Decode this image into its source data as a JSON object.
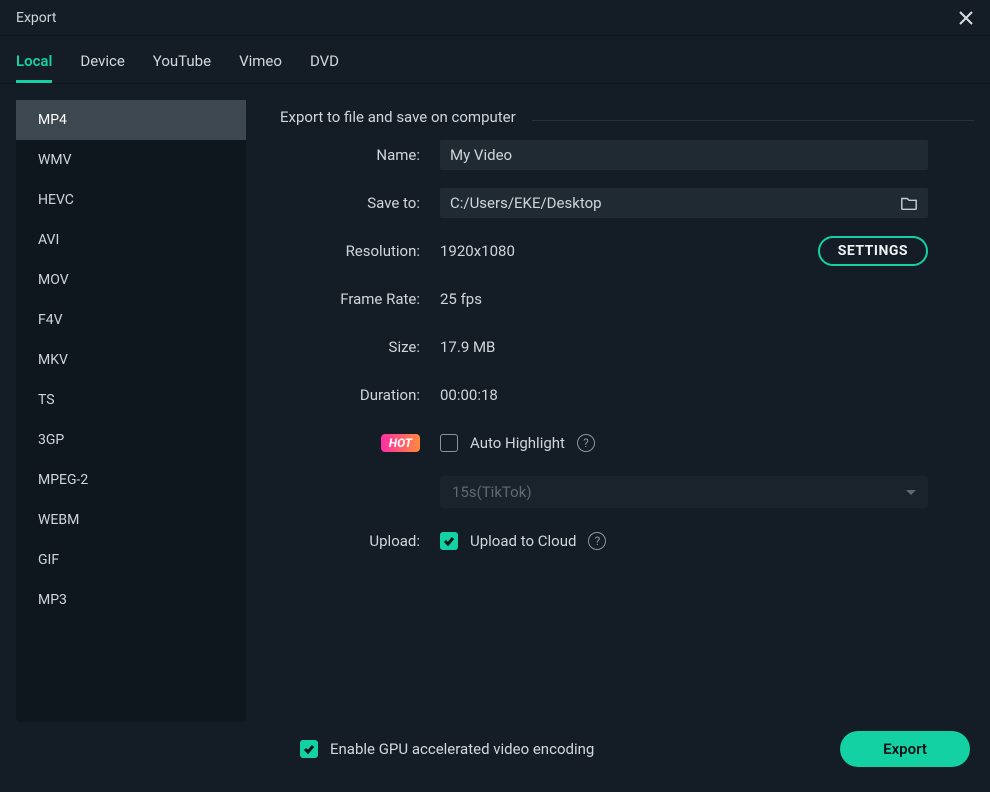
{
  "title": "Export",
  "tabs": [
    {
      "label": "Local",
      "active": true
    },
    {
      "label": "Device",
      "active": false
    },
    {
      "label": "YouTube",
      "active": false
    },
    {
      "label": "Vimeo",
      "active": false
    },
    {
      "label": "DVD",
      "active": false
    }
  ],
  "formats": [
    {
      "label": "MP4",
      "active": true
    },
    {
      "label": "WMV"
    },
    {
      "label": "HEVC"
    },
    {
      "label": "AVI"
    },
    {
      "label": "MOV"
    },
    {
      "label": "F4V"
    },
    {
      "label": "MKV"
    },
    {
      "label": "TS"
    },
    {
      "label": "3GP"
    },
    {
      "label": "MPEG-2"
    },
    {
      "label": "WEBM"
    },
    {
      "label": "GIF"
    },
    {
      "label": "MP3"
    }
  ],
  "section_title": "Export to file and save on computer",
  "labels": {
    "name": "Name:",
    "save_to": "Save to:",
    "resolution": "Resolution:",
    "frame_rate": "Frame Rate:",
    "size": "Size:",
    "duration": "Duration:",
    "upload": "Upload:"
  },
  "values": {
    "name": "My Video",
    "save_to": "C:/Users/EKE/Desktop",
    "resolution": "1920x1080",
    "frame_rate": "25 fps",
    "size": "17.9 MB",
    "duration": "00:00:18",
    "auto_highlight_label": "Auto Highlight",
    "preset_select": "15s(TikTok)",
    "upload_label": "Upload to Cloud"
  },
  "auto_highlight_checked": false,
  "upload_checked": true,
  "buttons": {
    "settings": "SETTINGS",
    "export": "Export"
  },
  "hot_badge": "HOT",
  "gpu_checkbox_label": "Enable GPU accelerated video encoding",
  "gpu_checked": true
}
